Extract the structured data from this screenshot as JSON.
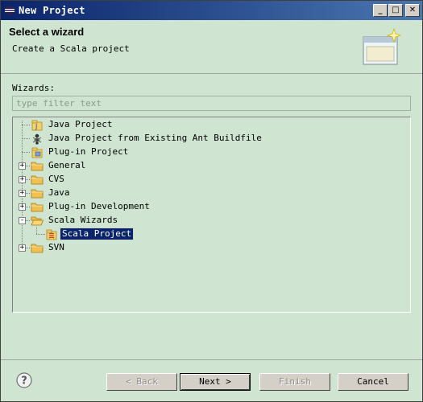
{
  "window": {
    "title": "New Project",
    "controls": {
      "minimize": "_",
      "maximize": "□",
      "close": "✕"
    }
  },
  "header": {
    "title": "Select a wizard",
    "description": "Create a Scala project"
  },
  "wizards_label": "Wizards:",
  "filter": {
    "placeholder": "type filter text",
    "value": ""
  },
  "tree": [
    {
      "label": "Java Project",
      "icon": "java-project-icon",
      "expander": null,
      "selected": false
    },
    {
      "label": "Java Project from Existing Ant Buildfile",
      "icon": "ant-icon",
      "expander": null,
      "selected": false
    },
    {
      "label": "Plug-in Project",
      "icon": "plugin-project-icon",
      "expander": null,
      "selected": false
    },
    {
      "label": "General",
      "icon": "folder-icon",
      "expander": "+",
      "selected": false
    },
    {
      "label": "CVS",
      "icon": "folder-icon",
      "expander": "+",
      "selected": false
    },
    {
      "label": "Java",
      "icon": "folder-icon",
      "expander": "+",
      "selected": false
    },
    {
      "label": "Plug-in Development",
      "icon": "folder-icon",
      "expander": "+",
      "selected": false
    },
    {
      "label": "Scala Wizards",
      "icon": "folder-open-icon",
      "expander": "-",
      "selected": false
    },
    {
      "label": "Scala Project",
      "icon": "scala-project-icon",
      "expander": null,
      "selected": true
    },
    {
      "label": "SVN",
      "icon": "folder-icon",
      "expander": "+",
      "selected": false
    }
  ],
  "buttons": {
    "help": "?",
    "back": "< Back",
    "next": "Next >",
    "finish": "Finish",
    "cancel": "Cancel"
  },
  "colors": {
    "title_bar": "#0a246a",
    "background": "#cfe5d2",
    "selection": "#0a246a",
    "button_face": "#d4d0c8",
    "folder": "#f0c050"
  }
}
